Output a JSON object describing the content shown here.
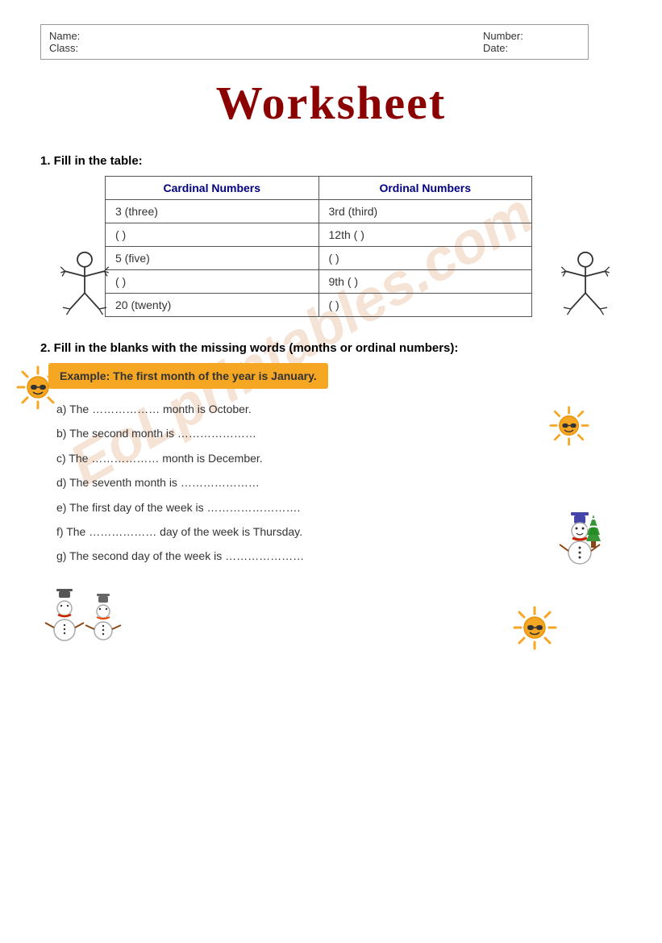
{
  "header": {
    "name_label": "Name:",
    "class_label": "Class:",
    "number_label": "Number:",
    "date_label": "Date:"
  },
  "title": "Worksheet",
  "watermark": "EoLprintables.com",
  "section1": {
    "instruction": "1. Fill in the table:",
    "table": {
      "col1_header": "Cardinal Numbers",
      "col2_header": "Ordinal Numbers",
      "rows": [
        {
          "cardinal": "3 (three)",
          "ordinal": "3rd  (third)"
        },
        {
          "cardinal": "(                       )",
          "ordinal": "12th  (                       )"
        },
        {
          "cardinal": "5 (five)",
          "ordinal": "(                       )"
        },
        {
          "cardinal": "(                       )",
          "ordinal": "9th  (                       )"
        },
        {
          "cardinal": "20 (twenty)",
          "ordinal": "(                       )"
        }
      ]
    }
  },
  "section2": {
    "instruction": "2. Fill in the blanks with the missing words (months or ordinal numbers):",
    "example": "Example: The first month of the year is January.",
    "items": [
      "a)  The ……………… month is October.",
      "b)  The second month is …………………",
      "c)  The ……………… month is December.",
      "d)  The seventh month is …………………",
      "e)  The first day of the week is …………………….",
      "f)   The ……………… day of the week is Thursday.",
      "g)   The second day of the week is …………………"
    ]
  }
}
